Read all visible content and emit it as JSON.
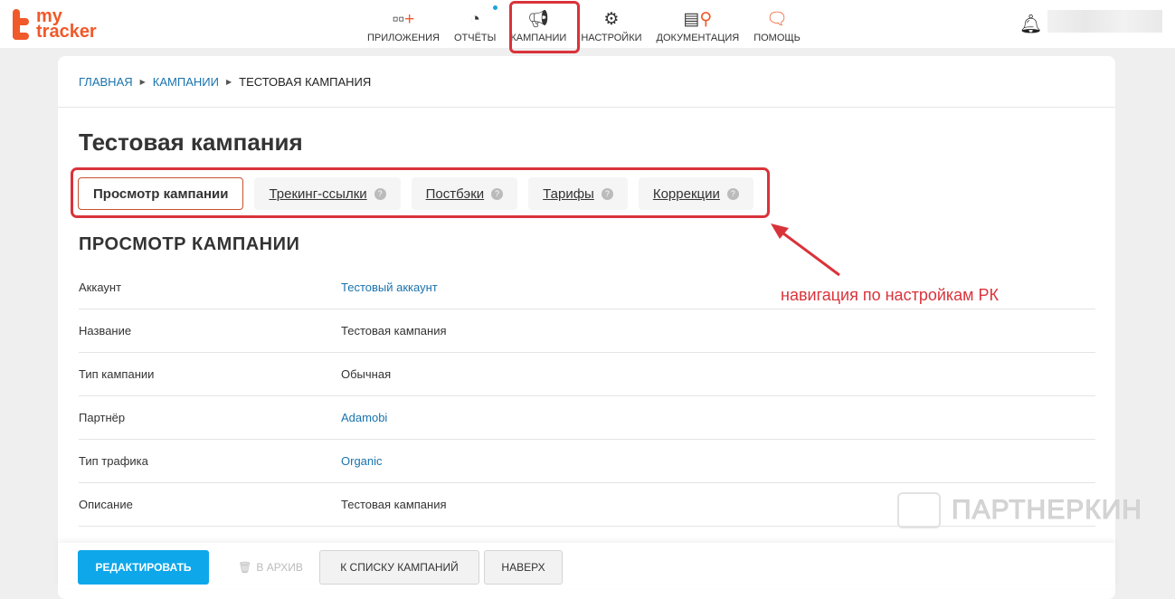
{
  "header": {
    "logo": "my tracker",
    "nav": [
      {
        "label": "ПРИЛОЖЕНИЯ",
        "icon": "apps-icon"
      },
      {
        "label": "ОТЧЁТЫ",
        "icon": "reports-icon"
      },
      {
        "label": "КАМПАНИИ",
        "icon": "megaphone-icon"
      },
      {
        "label": "НАСТРОЙКИ",
        "icon": "gear-icon"
      },
      {
        "label": "ДОКУМЕНТАЦИЯ",
        "icon": "docs-search-icon"
      },
      {
        "label": "ПОМОЩЬ",
        "icon": "chat-icon"
      }
    ]
  },
  "breadcrumb": [
    "ГЛАВНАЯ",
    "КАМПАНИИ",
    "ТЕСТОВАЯ КАМПАНИЯ"
  ],
  "title": "Тестовая кампания",
  "tabs": [
    "Просмотр кампании",
    "Трекинг-ссылки",
    "Постбэки",
    "Тарифы",
    "Коррекции"
  ],
  "section_title": "ПРОСМОТР КАМПАНИИ",
  "rows": [
    {
      "label": "Аккаунт",
      "value": "Тестовый аккаунт"
    },
    {
      "label": "Название",
      "value": "Тестовая кампания"
    },
    {
      "label": "Тип кампании",
      "value": "Обычная"
    },
    {
      "label": "Партнёр",
      "value": "Adamobi"
    },
    {
      "label": "Тип трафика",
      "value": "Organic"
    },
    {
      "label": "Описание",
      "value": "Тестовая кампания"
    }
  ],
  "footer": {
    "edit": "РЕДАКТИРОВАТЬ",
    "archive": "В АРХИВ",
    "to_list": "К СПИСКУ КАМПАНИЙ",
    "top": "НАВЕРХ"
  },
  "annotation": "навигация по настройкам РК",
  "watermark": "ПАРТНЕРКИН",
  "colors": {
    "brand": "#f0592a",
    "link": "#1a73ae",
    "primary": "#0ea7ea",
    "annotation": "#d9333a"
  }
}
